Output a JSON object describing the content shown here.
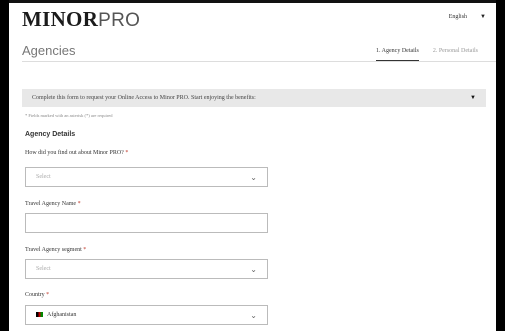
{
  "header": {
    "logo_bold": "MINOR",
    "logo_light": "PRO",
    "language": "English",
    "page_title": "Agencies",
    "steps": [
      "1. Agency Details",
      "2. Personal Details"
    ]
  },
  "info_bar": {
    "text": "Complete this form to request your Online Access to Minor PRO. Start enjoying the benefits:"
  },
  "required_note": "* Fields marked with an asterisk (*) are required",
  "section_title": "Agency Details",
  "fields": {
    "source": {
      "label": "How did you find out about Minor PRO?",
      "star": "*",
      "value": "Select"
    },
    "agency_name": {
      "label": "Travel Agency Name",
      "star": "*",
      "value": ""
    },
    "segment": {
      "label": "Travel Agency segment",
      "star": "*",
      "value": "Select"
    },
    "country": {
      "label": "Country",
      "star": "*",
      "value": "Afghanistan"
    }
  },
  "icons": {
    "dropdown": "chevron-down-icon",
    "caret": "caret-down-icon",
    "flag": "afghanistan-flag-icon"
  }
}
